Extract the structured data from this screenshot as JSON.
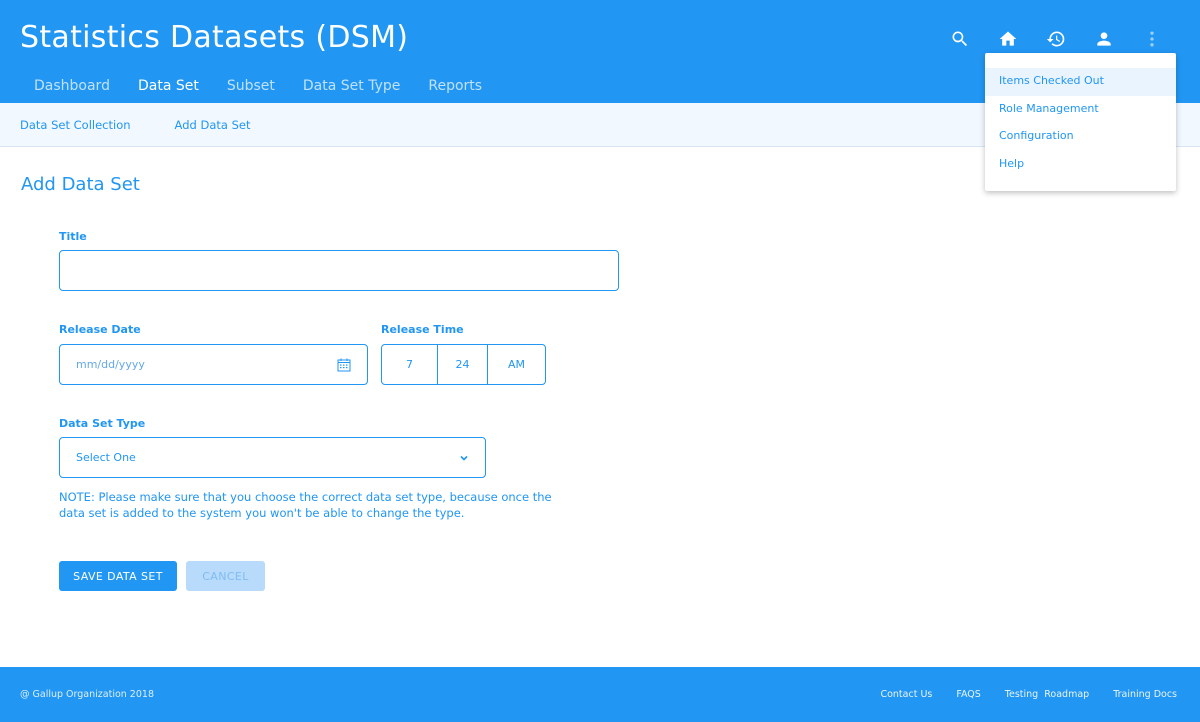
{
  "header": {
    "title": "Statistics Datasets (DSM)",
    "tabs": [
      {
        "label": "Dashboard"
      },
      {
        "label": "Data Set",
        "active": true
      },
      {
        "label": "Subset"
      },
      {
        "label": "Data Set Type"
      },
      {
        "label": "Reports"
      }
    ],
    "icons": [
      "search-icon",
      "home-icon",
      "history-icon",
      "account-icon",
      "more-vertical-icon"
    ]
  },
  "sub_nav": {
    "items": [
      {
        "label": "Data Set Collection"
      },
      {
        "label": "Add Data Set"
      }
    ]
  },
  "menu": {
    "items": [
      {
        "label": "Items Checked Out",
        "highlighted": true
      },
      {
        "label": "Role Management"
      },
      {
        "label": "Configuration"
      },
      {
        "label": "Help"
      }
    ]
  },
  "form": {
    "heading": "Add Data Set",
    "title_label": "Title",
    "title_value": "",
    "release_date_label": "Release Date",
    "release_date_placeholder": "mm/dd/yyyy",
    "release_time_label": "Release Time",
    "time_hour": "7",
    "time_minute": "24",
    "time_period": "AM",
    "type_label": "Data Set Type",
    "type_value": "Select One",
    "note": "NOTE: Please make sure that you choose the correct data set type, because once the data set is added to the system you won't be able to change the type.",
    "save_label": "SAVE DATA SET",
    "cancel_label": "CANCEL"
  },
  "footer": {
    "copyright": "@ Gallup Organization 2018",
    "links": [
      {
        "label": "Contact Us"
      },
      {
        "label": "FAQS"
      },
      {
        "label": "Testing  Roadmap"
      },
      {
        "label": "Training Docs"
      }
    ]
  },
  "colors": {
    "primary": "#2196f3",
    "subnav_bg": "#f2f8ff",
    "cancel_bg": "#b8dafb"
  }
}
